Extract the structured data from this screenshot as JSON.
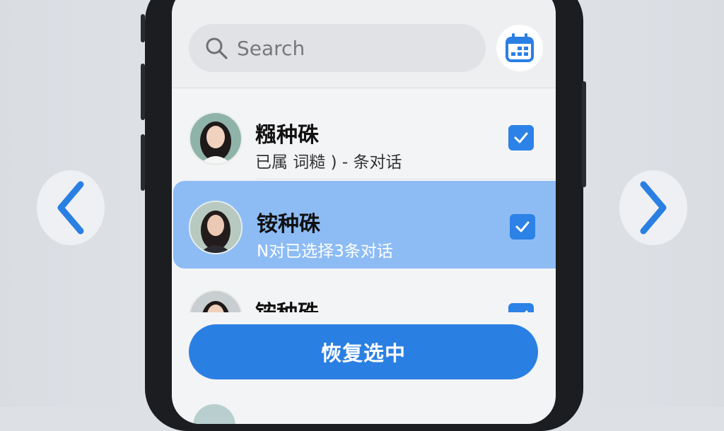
{
  "search": {
    "placeholder": "Search",
    "icon": "search-icon"
  },
  "header": {
    "calendar_icon": "calendar-icon"
  },
  "conversations": [
    {
      "name": "糨种硃",
      "subtitle": "已属 词糙 ) - 条对话",
      "checked": true,
      "selected": false
    },
    {
      "name": "铵种硃",
      "subtitle": "N对已选择3条对话",
      "checked": true,
      "selected": true
    },
    {
      "name": "铵种硃",
      "subtitle": "",
      "checked": true,
      "selected": false
    }
  ],
  "actions": {
    "restore_label": "恢复选中"
  },
  "nav": {
    "prev_icon": "chevron-left-icon",
    "next_icon": "chevron-right-icon"
  },
  "colors": {
    "accent": "#2a7fe3",
    "selected_row": "#8dbcf5",
    "checkbox": "#2c82e6"
  }
}
